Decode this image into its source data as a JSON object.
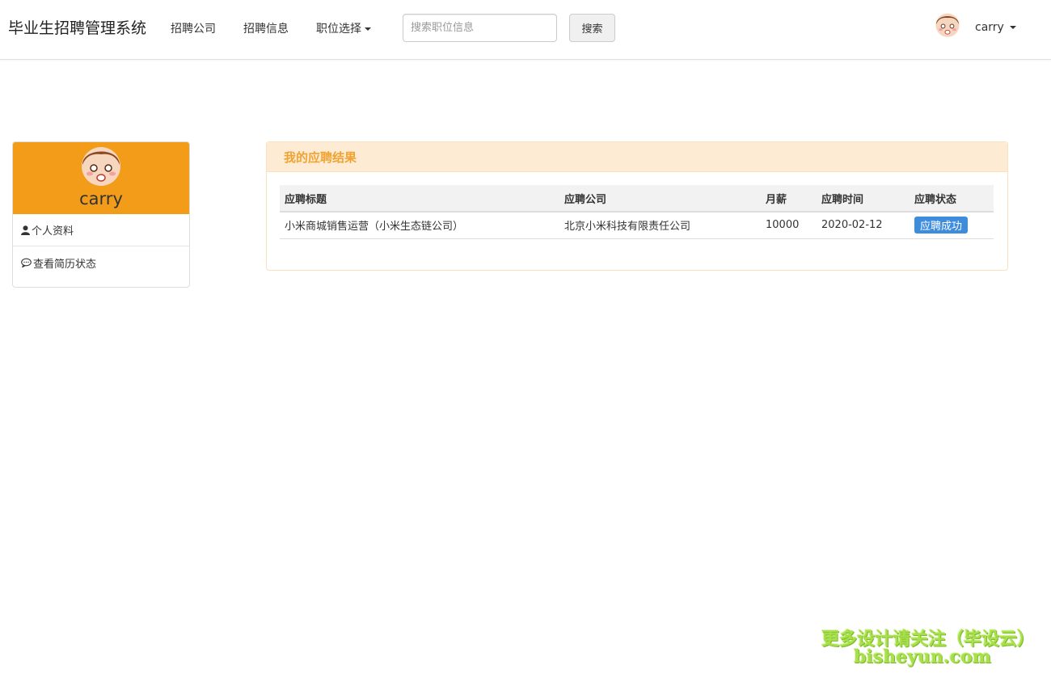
{
  "navbar": {
    "brand": "毕业生招聘管理系统",
    "links": [
      "招聘公司",
      "招聘信息"
    ],
    "dropdown_label": "职位选择",
    "search_placeholder": "搜索职位信息",
    "search_button": "搜索",
    "user_name": "carry"
  },
  "sidebar": {
    "user_name": "carry",
    "header_color": "#f39c19",
    "items": [
      {
        "label": "个人资料",
        "icon": "user-icon"
      },
      {
        "label": "查看简历状态",
        "icon": "comment-icon"
      }
    ]
  },
  "results": {
    "title": "我的应聘结果",
    "columns": [
      "应聘标题",
      "应聘公司",
      "月薪",
      "应聘时间",
      "应聘状态"
    ],
    "rows": [
      {
        "title": "小米商城销售运营（小米生态链公司）",
        "company": "北京小米科技有限责任公司",
        "salary": "10000",
        "date": "2020-02-12",
        "status": "应聘成功"
      }
    ],
    "status_color": "#3e8ddc"
  },
  "watermark": {
    "line1": "更多设计请关注（毕设云）",
    "line2": "bisheyun.com"
  }
}
